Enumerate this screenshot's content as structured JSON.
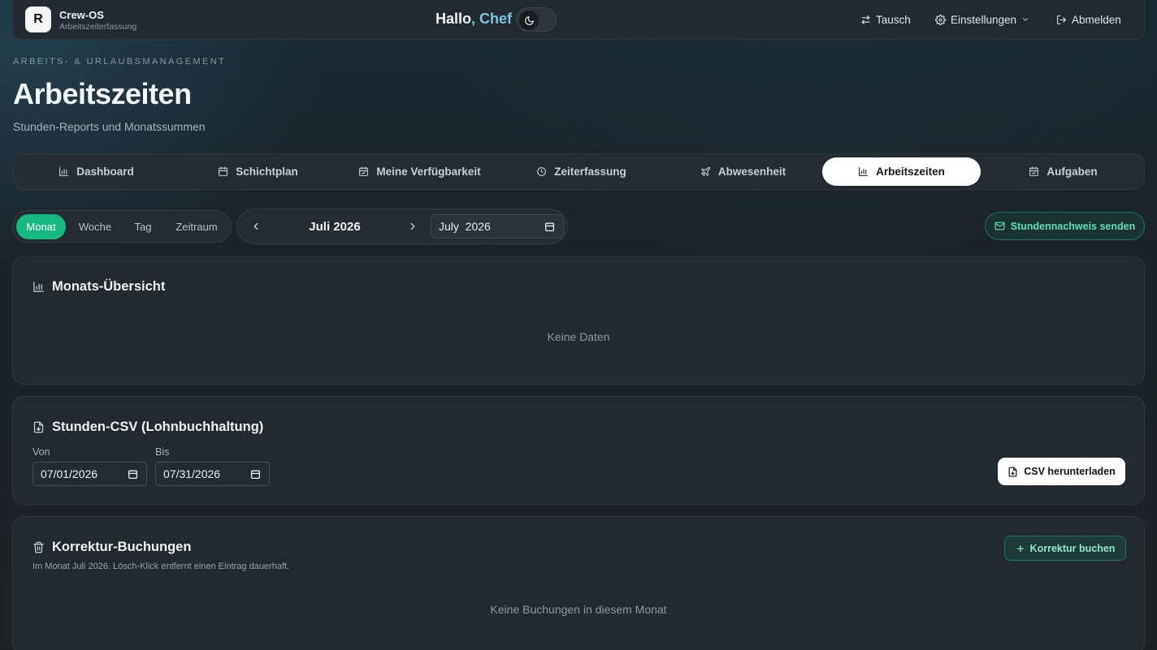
{
  "brand": {
    "logo_letter": "R",
    "name": "Crew-OS",
    "subtitle": "Arbeitszeiterfassung"
  },
  "greeting": {
    "hello": "Hallo",
    "comma": ",",
    "name": "Chef"
  },
  "top_actions": {
    "swap": "Tausch",
    "settings": "Einstellungen",
    "logout": "Abmelden"
  },
  "header": {
    "eyebrow": "ARBEITS- & URLAUBSMANAGEMENT",
    "title": "Arbeitszeiten",
    "subtitle": "Stunden-Reports und Monatssummen"
  },
  "tabs": [
    {
      "label": "Dashboard",
      "icon": "bar-chart-icon"
    },
    {
      "label": "Schichtplan",
      "icon": "calendar-icon"
    },
    {
      "label": "Meine Verfügbarkeit",
      "icon": "calendar-check-icon"
    },
    {
      "label": "Zeiterfassung",
      "icon": "clock-icon"
    },
    {
      "label": "Abwesenheit",
      "icon": "plane-icon"
    },
    {
      "label": "Arbeitszeiten",
      "icon": "bar-chart-icon",
      "active": true
    },
    {
      "label": "Aufgaben",
      "icon": "calendar-check-icon"
    }
  ],
  "period": {
    "options": [
      "Monat",
      "Woche",
      "Tag",
      "Zeitraum"
    ],
    "selected": "Monat",
    "month_label": "Juli 2026",
    "month_input_value": "July  2026"
  },
  "send_button": "Stundennachweis senden",
  "overview": {
    "title": "Monats-Übersicht",
    "empty": "Keine Daten"
  },
  "csv": {
    "title": "Stunden-CSV (Lohnbuchhaltung)",
    "from_label": "Von",
    "from_value": "07/01/2026",
    "to_label": "Bis",
    "to_value": "07/31/2026",
    "download_button": "CSV herunterladen"
  },
  "corrections": {
    "title": "Korrektur-Buchungen",
    "note": "Im Monat Juli 2026. Lösch-Klick entfernt einen Eintrag dauerhaft.",
    "add_button": "Korrektur buchen",
    "empty": "Keine Buchungen in diesem Monat"
  },
  "colors": {
    "accent": "#16b982",
    "accent_text": "#5fe0b2",
    "background": "#1b2328"
  }
}
